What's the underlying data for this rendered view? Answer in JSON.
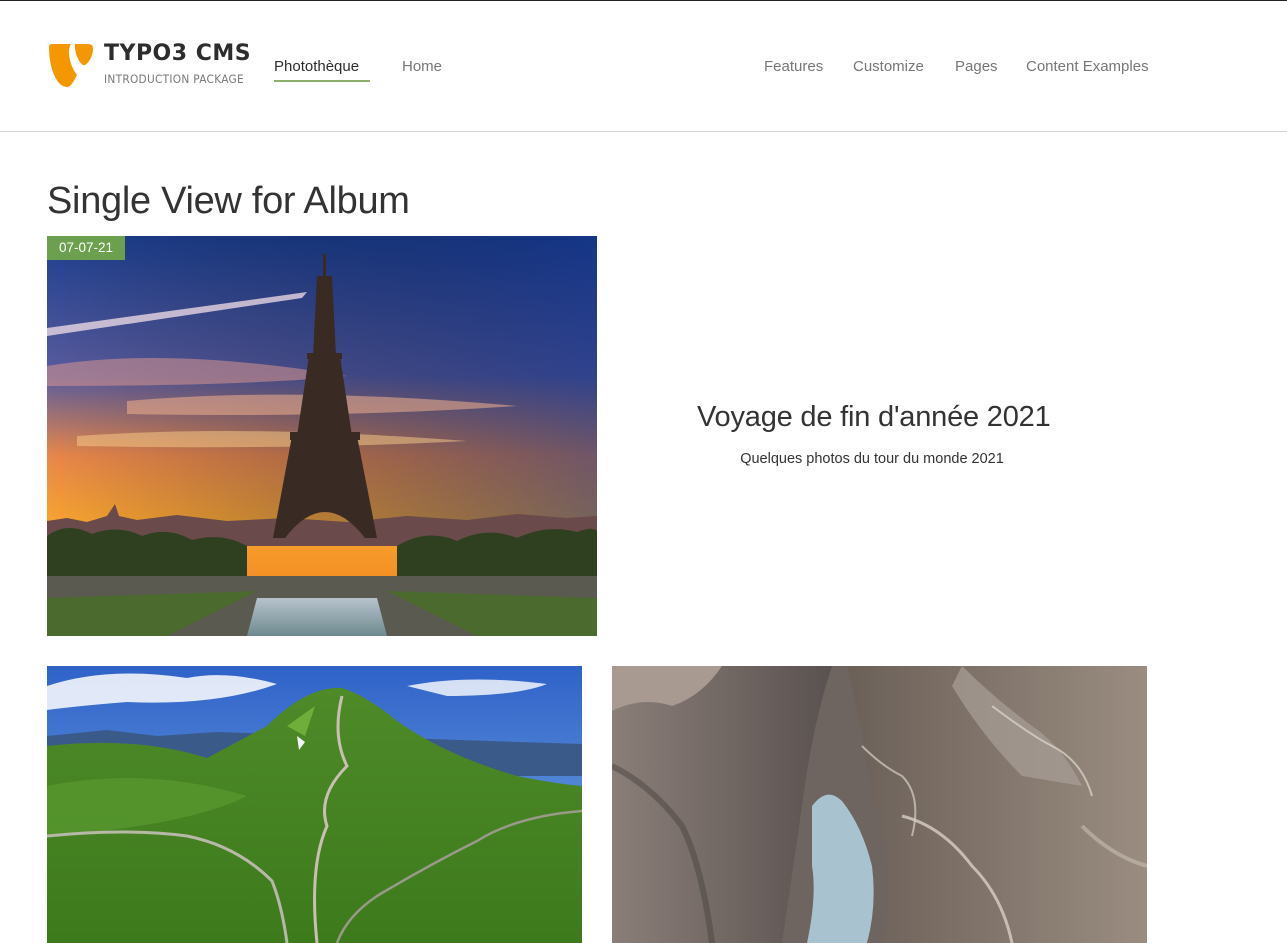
{
  "brand": {
    "title": "TYPO3 CMS",
    "subtitle": "INTRODUCTION PACKAGE",
    "accent_color": "#f49700"
  },
  "nav": {
    "primary": [
      {
        "label": "Photothèque",
        "active": true
      },
      {
        "label": "Home",
        "active": false
      }
    ],
    "secondary": [
      {
        "label": "Features"
      },
      {
        "label": "Customize"
      },
      {
        "label": "Pages"
      },
      {
        "label": "Content Examples"
      }
    ],
    "active_color": "#8cb06a"
  },
  "page": {
    "title": "Single View for Album"
  },
  "album": {
    "date": "07-07-21",
    "title": "Voyage de fin d'année 2021",
    "description": "Quelques photos du tour du monde 2021",
    "badge_color": "#6c9f4e"
  },
  "photos": [
    {
      "subject": "eiffel-tower-sunset"
    },
    {
      "subject": "green-mountain-road"
    },
    {
      "subject": "rocky-canyon-river"
    }
  ]
}
